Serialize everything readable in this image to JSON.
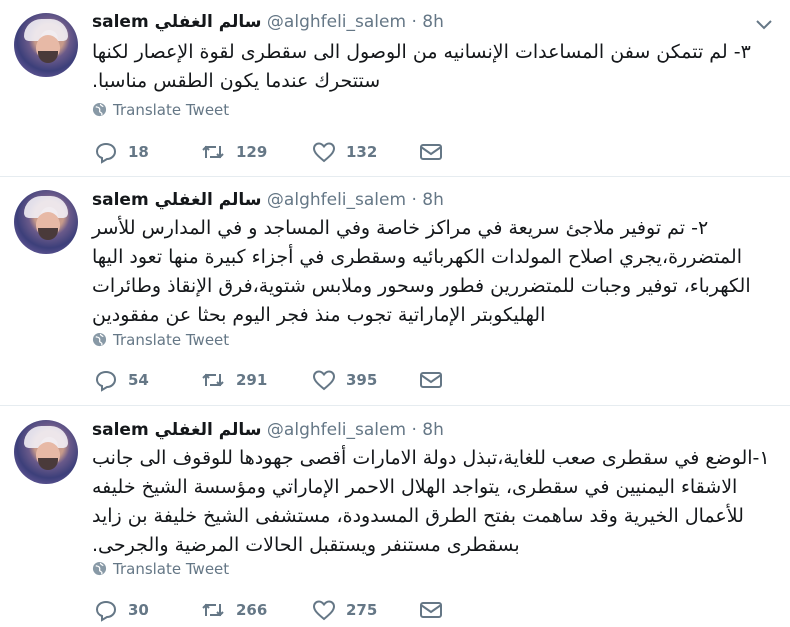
{
  "tweets": [
    {
      "name": "salem سالم الغفلي",
      "handle": "@alghfeli_salem",
      "dot": "·",
      "time": "8h",
      "text": "٣- لم تتمكن سفن المساعدات الإنسانيه من الوصول الى سقطرى لقوة الإعصار لكنها ستتحرك عندما يكون الطقس مناسبا.",
      "translate_label": "Translate Tweet",
      "replies": "18",
      "retweets": "129",
      "likes": "132"
    },
    {
      "name": "salem سالم الغفلي",
      "handle": "@alghfeli_salem",
      "dot": "·",
      "time": "8h",
      "text": "٢- تم توفير ملاجئ سريعة في مراكز خاصة وفي المساجد و في المدارس للأسر المتضررة،يجري اصلاح المولدات الكهربائيه وسقطرى  في أجزاء كبيرة منها تعود اليها الكهرباء، توفير وجبات للمتضررين فطور وسحور وملابس شتوية،فرق الإنقاذ وطائرات الهليكوبتر الإماراتية تجوب منذ فجر اليوم بحثا عن مفقودين",
      "translate_label": "Translate Tweet",
      "replies": "54",
      "retweets": "291",
      "likes": "395"
    },
    {
      "name": "salem سالم الغفلي",
      "handle": "@alghfeli_salem",
      "dot": "·",
      "time": "8h",
      "text": "١-الوضع في سقطرى صعب للغاية،تبذل دولة الامارات أقصى جهودها للوقوف الى جانب الاشقاء اليمنيين في سقطرى، يتواجد الهلال الاحمر الإماراتي ومؤسسة الشيخ خليفه للأعمال الخيرية وقد ساهمت بفتح الطرق المسدودة، مستشفى الشيخ خليفة بن زايد بسقطرى مستنفر ويستقبل الحالات المرضية والجرحى.",
      "translate_label": "Translate Tweet",
      "replies": "30",
      "retweets": "266",
      "likes": "275"
    }
  ],
  "icons": {
    "avatar": "avatar-photo",
    "menu": "chevron-down-icon",
    "globe": "globe-icon",
    "reply": "reply-icon",
    "retweet": "retweet-icon",
    "like": "heart-icon",
    "dm": "envelope-icon"
  },
  "colors": {
    "text": "#14171a",
    "secondary": "#657786",
    "divider": "#e6ecf0"
  }
}
